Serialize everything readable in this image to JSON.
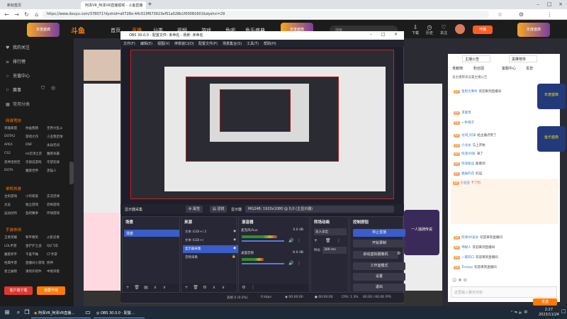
{
  "browser": {
    "tabs": [
      {
        "label": "新标签页",
        "active": false
      },
      {
        "label": "阿泽VR_阿泽VR直播视频 - 斗鱼直播",
        "active": true
      }
    ],
    "new_tab": "+",
    "url": "https://www.douyu.com/378071?dyshid=a0728e-44c519f673623ef51a028b1f00081601&dyshci=29"
  },
  "douyu": {
    "logo": "斗鱼",
    "nav": [
      {
        "label": "首页",
        "active": false
      },
      {
        "label": "直播",
        "active": true
      },
      {
        "label": "分类",
        "active": false
      },
      {
        "label": "视频",
        "active": false
      },
      {
        "label": "游戏",
        "active": false
      },
      {
        "label": "鱼吧",
        "active": false
      },
      {
        "label": "鱼乐盛典",
        "active": false
      }
    ],
    "banner_badge": "年度盛典",
    "search_placeholder": "搜索",
    "header_icons": [
      {
        "label": "下载",
        "icon": "download-icon"
      },
      {
        "label": "历史",
        "icon": "history-icon"
      },
      {
        "label": "关注",
        "icon": "follow-icon"
      },
      {
        "label": "个人中心",
        "icon": "user-center-icon"
      }
    ],
    "open_live": "开播",
    "sidebar": {
      "items": [
        {
          "label": "我的关注",
          "icon": "♥"
        },
        {
          "label": "排行榜",
          "icon": "≡"
        },
        {
          "label": "充值中心",
          "icon": "☆"
        },
        {
          "label": "赛事",
          "icon": "⚐"
        }
      ],
      "usual": "常用分类",
      "sections": [
        {
          "title": "网游竞技",
          "cats": [
            "英雄联盟",
            "你画我猜",
            "无界大乱斗",
            "DOTA2",
            "游戏大作",
            "小丑我足球",
            "APEX",
            "DNF",
            "永劫无间",
            "CS2",
            "lol云顶之弈",
            "魔兽争霸",
            "黑神话悟空",
            "华丽说游戏",
            "守望先锋",
            "DOTA",
            "魔兽世界",
            "黑猫人"
          ]
        },
        {
          "title": "单机热游",
          "cats": [
            "主机游戏",
            "小鸡家族",
            "实况足球",
            "太吴",
            "独立游戏",
            "恐怖游戏",
            "运动创作",
            "鱼吧赛季",
            "环球游戏"
          ]
        },
        {
          "title": "手游休闲",
          "cats": [
            "王者荣耀",
            "和平精英",
            "火影忍者",
            "LOL手游",
            "金铲铲之战",
            "QQ飞车",
            "魔兽奖平",
            "千喜不做",
            "CF手游",
            "经典手游",
            "直播间小游戏",
            "原神",
            "星之破晓",
            "请场外软件",
            "中接诉套"
          ]
        }
      ],
      "buttons": [
        {
          "label": "客户端下载",
          "icon": "download-icon"
        },
        {
          "label": "我要开播",
          "icon": "live-icon"
        }
      ]
    },
    "chat": {
      "tabs": [
        "主播公告",
        "黑推榜单",
        "贡献榜",
        "粉丝团",
        "客服中心",
        "贵宾"
      ],
      "notice": "该主播暂未设置主播公告",
      "lines": [
        {
          "lv": "LV",
          "name": "鱼吧大事件",
          "text": "欢迎来到直播间"
        },
        {
          "lv": "LV",
          "name": "求富贵",
          "text": ""
        },
        {
          "lv": "LV",
          "name": "一秒拽子",
          "text": ""
        },
        {
          "lv": "LV",
          "name": "龙哥_阿泽",
          "text": "给主播点赞了"
        },
        {
          "lv": "LV",
          "name": "小龙女",
          "text": "马上开始"
        },
        {
          "lv": "LV",
          "name": "阿泽VR粉",
          "text": "来了"
        },
        {
          "lv": "LV",
          "name": "阿泽粉丝",
          "text": "能看到"
        },
        {
          "lv": "LV",
          "name": "姐妹的花",
          "text": "好运"
        },
        {
          "lv": "LV",
          "name": "小豆豆",
          "text": "卡了吗"
        },
        {
          "lv": "LV",
          "name": "阿泽VR美女",
          "text": "欢迎来到直播间"
        },
        {
          "lv": "LV",
          "name": "神秘人",
          "text": "欢迎来到直播间"
        },
        {
          "lv": "LV",
          "name": "一家四口",
          "text": "欢迎来到直播间"
        },
        {
          "lv": "LV",
          "name": "Treejoy",
          "text": "欢迎来到直播间"
        }
      ],
      "input_placeholder": "这里输入聊天内容",
      "send": "发送",
      "side_banners": [
        "年度盛典",
        "鱼乐盛典"
      ]
    },
    "room_promo": "一人独骑传说"
  },
  "obs": {
    "title": "OBS 30.0.0 - 配置文件: 未命名 - 场景: 未命名",
    "menu": [
      "文件(F)",
      "编辑(E)",
      "视图(V)",
      "停靠窗口(D)",
      "配置文件(P)",
      "场景集合(S)",
      "工具(T)",
      "帮助(H)"
    ],
    "strip": {
      "label": "显示器采集",
      "props": "属性",
      "filters": "滤镜",
      "display": "显示器",
      "display_value": "MG248: 1920x1080 @ 0,0 (主显示器)"
    },
    "docks": {
      "scenes": {
        "title": "场景",
        "items": [
          {
            "label": "场景",
            "selected": true
          }
        ]
      },
      "sources": {
        "title": "来源",
        "items": [
          {
            "label": "文本 (GDI+) 2",
            "selected": false
          },
          {
            "label": "文本 (GDI+)",
            "selected": false
          },
          {
            "label": "显示器采集",
            "selected": true
          },
          {
            "label": "音频采集",
            "selected": false
          }
        ]
      },
      "mixer": {
        "title": "混音器",
        "channels": [
          {
            "name": "麦克风/Aux",
            "db": "0.0 dB",
            "level": 0.55
          },
          {
            "name": "桌面音频",
            "db": "-6.0 dB",
            "level": 0.35
          }
        ]
      },
      "transitions": {
        "title": "转场动画",
        "type": "淡入淡出",
        "duration_label": "时长",
        "duration": "300 ms"
      },
      "controls": {
        "title": "控制按钮",
        "buttons": [
          {
            "label": "停止直播",
            "primary": true
          },
          {
            "label": "开始录制",
            "primary": false
          },
          {
            "label": "启动虚拟摄像机",
            "primary": false
          },
          {
            "label": "工作室模式",
            "primary": false
          },
          {
            "label": "设置",
            "primary": false
          },
          {
            "label": "退出",
            "primary": false
          }
        ]
      }
    },
    "status": {
      "dropped": "丢帧 0 (0.0%)",
      "kbps": "0 kbps",
      "live_time": "00:00:00",
      "rec_time": "00:00:00",
      "cpu": "CPU: 1.3%",
      "fps": "60.00 / 60.00 FPS"
    }
  },
  "taskbar": {
    "apps": [
      {
        "label": "阿泽VR_阿泽VR直播...",
        "icon": "chrome-icon"
      },
      {
        "label": "OBS 30.0.0 - 配置...",
        "icon": "obs-icon"
      }
    ],
    "lang": "中",
    "time": "2:27",
    "date": "2023/11/24"
  }
}
